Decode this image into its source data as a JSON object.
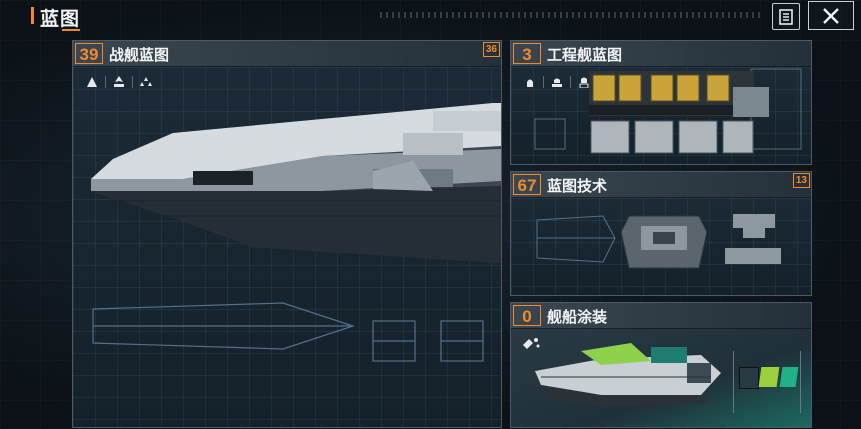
{
  "header": {
    "title": "蓝图",
    "notes_icon": "notes-icon",
    "close_icon": "close-icon"
  },
  "panels": {
    "battleship": {
      "count": "39",
      "title": "战舰蓝图",
      "badge": "36",
      "filters": [
        "fighter-class-icon",
        "cruiser-class-icon",
        "fleet-class-icon"
      ]
    },
    "engineering": {
      "count": "3",
      "title": "工程舰蓝图",
      "filters": [
        "class-a-icon",
        "class-b-icon",
        "class-c-icon"
      ]
    },
    "tech": {
      "count": "67",
      "title": "蓝图技术",
      "badge": "13"
    },
    "skin": {
      "count": "0",
      "title": "舰船涂装",
      "skin_icon": "paint-icon"
    }
  },
  "colors": {
    "accent": "#f08a2a",
    "panel_border": "#4b5a66",
    "skin_swatches": [
      "#2a3a44",
      "#9ccf3a",
      "#21b088"
    ]
  }
}
